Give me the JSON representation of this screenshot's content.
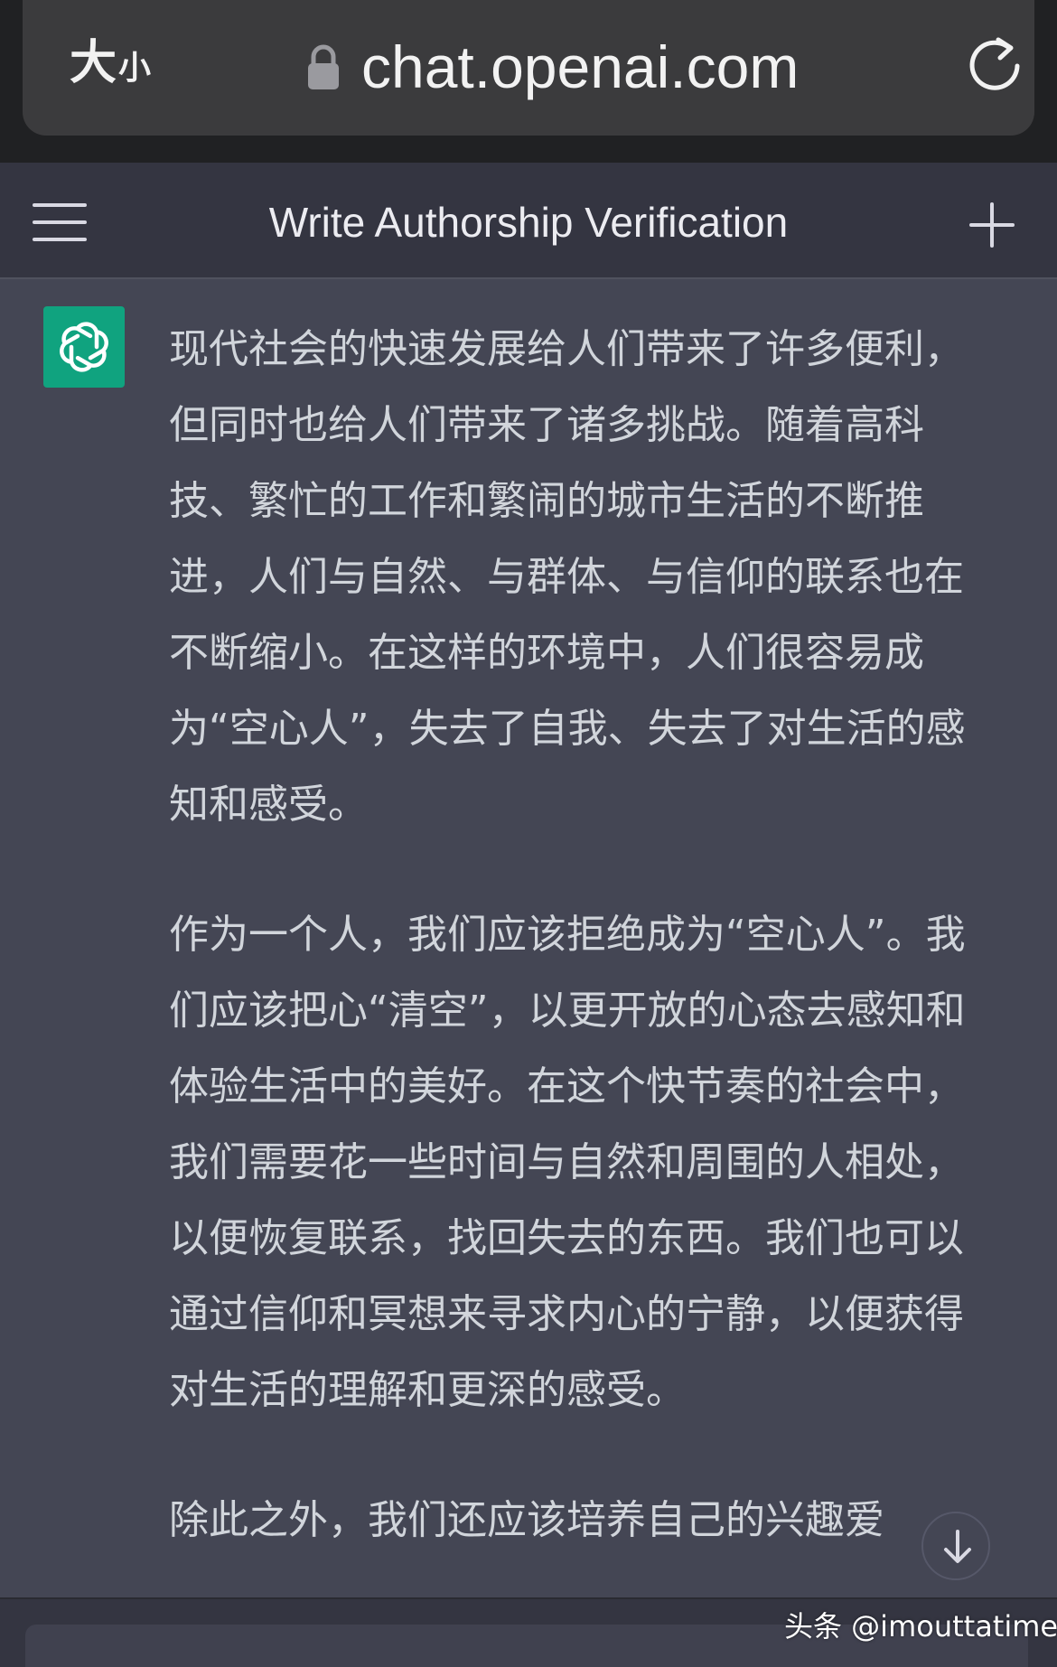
{
  "browser": {
    "size_toggle_big": "大",
    "size_toggle_small": "小",
    "url": "chat.openai.com",
    "lock_icon": "lock-icon",
    "reload_icon": "reload-icon"
  },
  "header": {
    "title": "Write Authorship Verification",
    "menu_icon": "hamburger-menu-icon",
    "new_chat_icon": "plus-icon"
  },
  "message": {
    "avatar_icon": "openai-logo-icon",
    "paragraphs": [
      "现代社会的快速发展给人们带来了许多便利，但同时也给人们带来了诸多挑战。随着高科技、繁忙的工作和繁闹的城市生活的不断推进，人们与自然、与群体、与信仰的联系也在不断缩小。在这样的环境中，人们很容易成为“空心人”，失去了自我、失去了对生活的感知和感受。",
      "作为一个人，我们应该拒绝成为“空心人”。我们应该把心“清空”，以更开放的心态去感知和体验生活中的美好。在这个快节奏的社会中，我们需要花一些时间与自然和周围的人相处，以便恢复联系，找回失去的东西。我们也可以通过信仰和冥想来寻求内心的宁静，以便获得对生活的理解和更深的感受。",
      "除此之外，我们还应该培养自己的兴趣爱"
    ]
  },
  "watermark": "头条 @imouttatime",
  "colors": {
    "background": "#444654",
    "header": "#343541",
    "accent": "#10a37f",
    "text": "#d1d5db"
  }
}
